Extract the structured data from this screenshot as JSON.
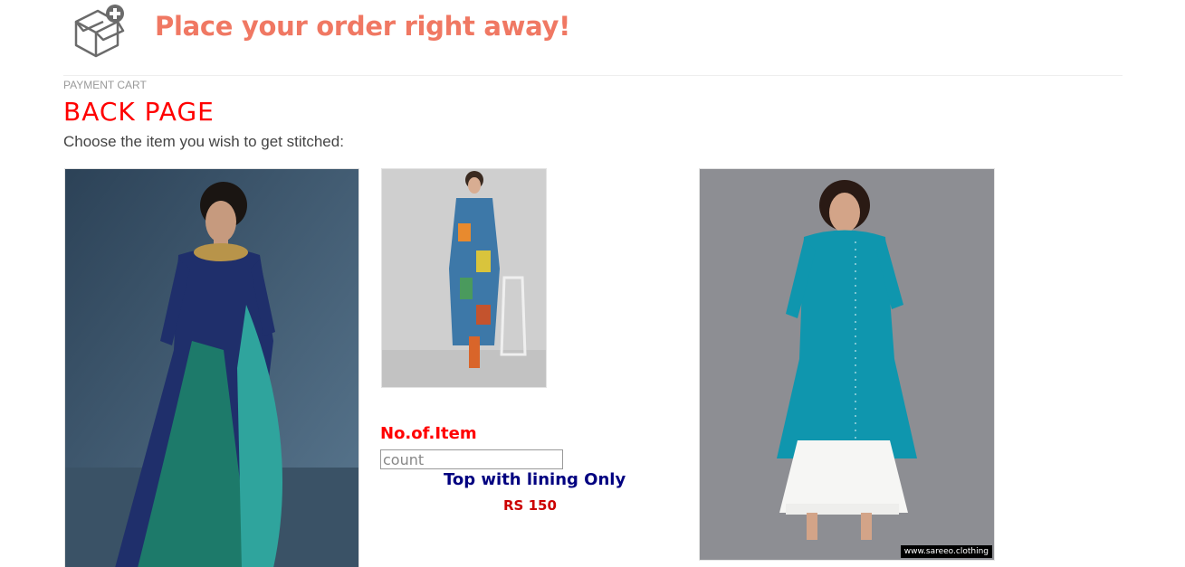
{
  "header": {
    "title": "Place your order right away!",
    "icon": "box-add-icon"
  },
  "breadcrumb": "PAYMENT CART",
  "page_heading": "BACK PAGE",
  "instruction": "Choose the item you wish to get stitched:",
  "products": {
    "left_image": "kurta-gown-teal-navy-image",
    "middle_image": "kurta-printed-multicolor-image",
    "right_image": "kurta-teal-palazzo-image",
    "right_watermark": "www.sareeo.clothing"
  },
  "order_form": {
    "quantity_label": "No.of.Item",
    "quantity_placeholder": "count",
    "quantity_value": "",
    "item_name": "Top with lining Only",
    "item_price": "RS 150"
  },
  "colors": {
    "title": "#f07863",
    "heading": "#ff0000",
    "item_name": "#000080",
    "price": "#cc0000"
  }
}
